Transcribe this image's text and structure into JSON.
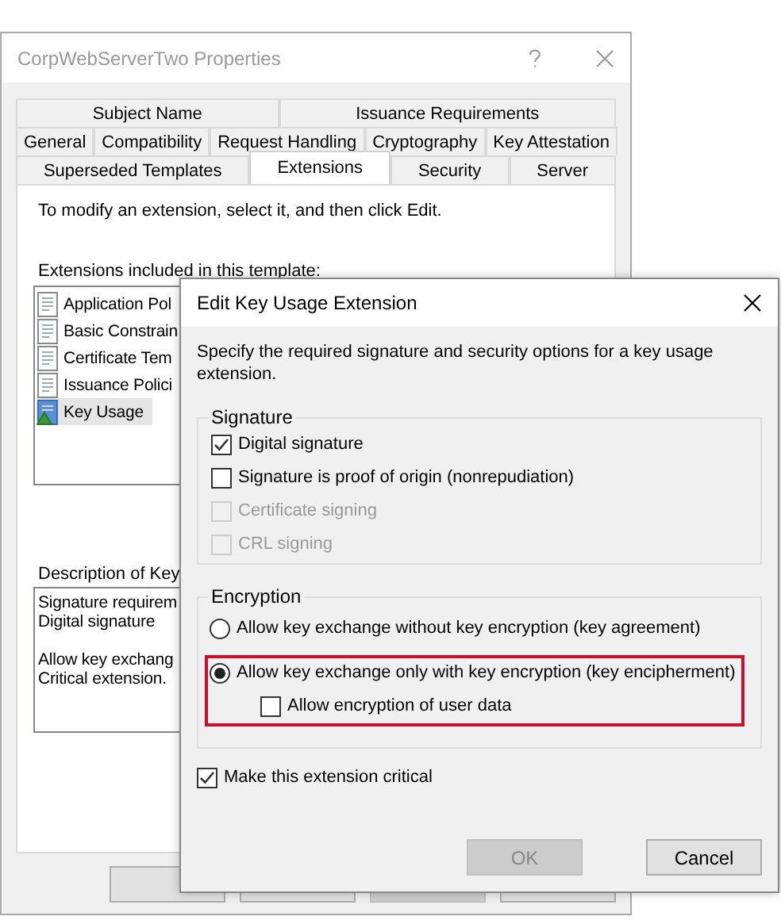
{
  "properties_window": {
    "title": "CorpWebServerTwo Properties",
    "tab_rows": [
      [
        {
          "label": "Subject Name",
          "selected": false
        },
        {
          "label": "Issuance Requirements",
          "selected": false
        }
      ],
      [
        {
          "label": "General",
          "selected": false
        },
        {
          "label": "Compatibility",
          "selected": false
        },
        {
          "label": "Request Handling",
          "selected": false
        },
        {
          "label": "Cryptography",
          "selected": false
        },
        {
          "label": "Key Attestation",
          "selected": false
        }
      ],
      [
        {
          "label": "Superseded Templates",
          "selected": false
        },
        {
          "label": "Extensions",
          "selected": true
        },
        {
          "label": "Security",
          "selected": false
        },
        {
          "label": "Server",
          "selected": false
        }
      ]
    ],
    "instruction": "To modify an extension, select it, and then click Edit.",
    "extensions_label": "Extensions included in this template:",
    "extensions": [
      {
        "label": "Application Pol",
        "kind": "plain",
        "selected": false
      },
      {
        "label": "Basic Constrain",
        "kind": "plain",
        "selected": false
      },
      {
        "label": "Certificate Tem",
        "kind": "plain",
        "selected": false
      },
      {
        "label": "Issuance Polici",
        "kind": "plain",
        "selected": false
      },
      {
        "label": "Key Usage",
        "kind": "key",
        "selected": true
      }
    ],
    "description_label": "Description of Key",
    "description": [
      [
        "Signature requirem",
        "Digital signature"
      ],
      [
        "Allow key exchang",
        "Critical extension."
      ]
    ],
    "buttons": [
      {
        "disabled": false
      },
      {
        "disabled": false
      },
      {
        "disabled": true
      },
      {
        "disabled": false
      }
    ]
  },
  "dialog": {
    "title": "Edit Key Usage Extension",
    "instruction": "Specify the required signature and security options for a key usage extension.",
    "signature": {
      "legend": "Signature",
      "options": [
        {
          "label": "Digital signature",
          "checked": true,
          "disabled": false
        },
        {
          "label": "Signature is proof of origin (nonrepudiation)",
          "checked": false,
          "disabled": false
        },
        {
          "label": "Certificate signing",
          "checked": false,
          "disabled": true
        },
        {
          "label": "CRL signing",
          "checked": false,
          "disabled": true
        }
      ]
    },
    "encryption": {
      "legend": "Encryption",
      "options": [
        {
          "kind": "radio",
          "label": "Allow key exchange without key encryption (key agreement)",
          "selected": false,
          "highlighted": false
        },
        {
          "kind": "radio",
          "label": "Allow key exchange only with key encryption (key encipherment)",
          "selected": true,
          "highlighted": true,
          "children": [
            {
              "kind": "checkbox",
              "label": "Allow encryption of user data",
              "checked": false
            }
          ]
        }
      ]
    },
    "critical": {
      "label": "Make this extension critical",
      "checked": true
    },
    "buttons": [
      {
        "label": "OK",
        "disabled": true
      },
      {
        "label": "Cancel",
        "disabled": false
      }
    ]
  }
}
